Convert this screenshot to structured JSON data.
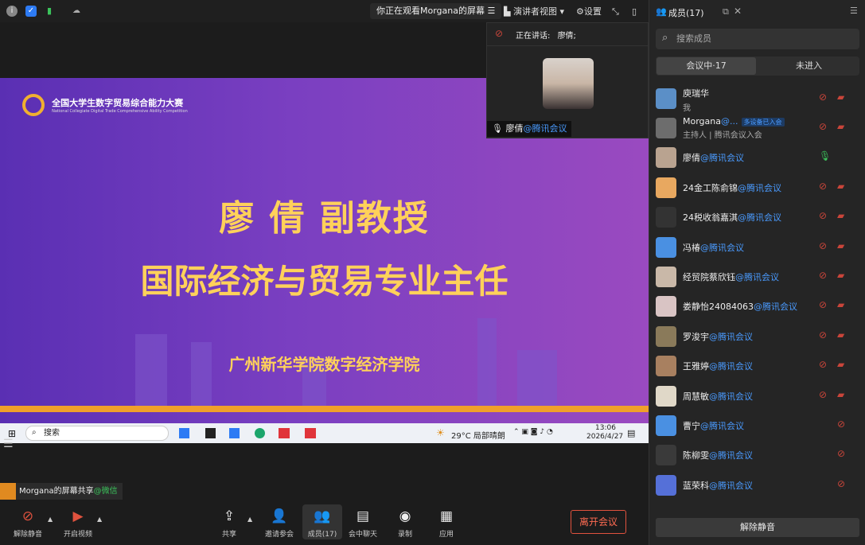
{
  "topbar": {
    "watching": "你正在观看Morgana的屏幕",
    "presenter_view": "演讲者视图",
    "settings": "设置"
  },
  "slide": {
    "logo_name": "全国大学生数字贸易综合能力大赛",
    "logo_sub": "National Collegiate Digital Trade Comprehensive Ability Competition",
    "title": "廖 倩 副教授",
    "subtitle": "国际经济与贸易专业主任",
    "school": "广州新华学院数字经济学院"
  },
  "taskbar": {
    "search": "搜索",
    "weather": "29°C 局部晴朗",
    "time": "13:06",
    "date": "2026/4/27"
  },
  "speaker": {
    "label": "正在讲话:",
    "name": "廖倩;",
    "tile_name": "廖倩",
    "tile_org": "@腾讯会议"
  },
  "share_label": {
    "text": "Morgana的屏幕共享",
    "app": "@微信"
  },
  "bottom": {
    "unmute": "解除静音",
    "video": "开启视频",
    "share": "共享",
    "invite": "邀请参会",
    "members": "成员(17)",
    "chat": "会中聊天",
    "record": "录制",
    "apps": "应用",
    "leave": "离开会议"
  },
  "side": {
    "title": "成员(17)",
    "search_placeholder": "搜索成员",
    "tab_in": "会议中·17",
    "tab_out": "未进入",
    "unmute_all": "解除静音",
    "members": [
      {
        "name": "庾瑞华",
        "org": "",
        "sub": "我",
        "color": "#5b8fc7"
      },
      {
        "name": "Morgana",
        "org": "@...",
        "sub": "主持人 | 腾讯会议入会",
        "badge": "多设备已入会",
        "color": "#6d6d6d"
      },
      {
        "name": "廖倩",
        "org": "@腾讯会议",
        "sub": "",
        "color": "#b9a390"
      },
      {
        "name": "24金工陈俞锦",
        "org": "@腾讯会议",
        "sub": "",
        "color": "#e8a860"
      },
      {
        "name": "24税收翁嘉淇",
        "org": "@腾讯会议",
        "sub": "",
        "color": "#333333"
      },
      {
        "name": "冯椿",
        "org": "@腾讯会议",
        "sub": "",
        "color": "#4a90e2"
      },
      {
        "name": "经贸院蔡欣钰",
        "org": "@腾讯会议",
        "sub": "",
        "color": "#c9b8a8"
      },
      {
        "name": "娄静怡24084063",
        "org": "@腾讯会议",
        "sub": "",
        "color": "#d9c4c4"
      },
      {
        "name": "罗浚宇",
        "org": "@腾讯会议",
        "sub": "",
        "color": "#8a7a5a"
      },
      {
        "name": "王雅婷",
        "org": "@腾讯会议",
        "sub": "",
        "color": "#a88060"
      },
      {
        "name": "周慧敏",
        "org": "@腾讯会议",
        "sub": "",
        "color": "#e0d8c8"
      },
      {
        "name": "曹宁",
        "org": "@腾讯会议",
        "sub": "",
        "color": "#4a90e2"
      },
      {
        "name": "陈柳雯",
        "org": "@腾讯会议",
        "sub": "",
        "color": "#3a3a3a"
      },
      {
        "name": "蓝荣科",
        "org": "@腾讯会议",
        "sub": "",
        "color": "#5570d8"
      }
    ]
  }
}
